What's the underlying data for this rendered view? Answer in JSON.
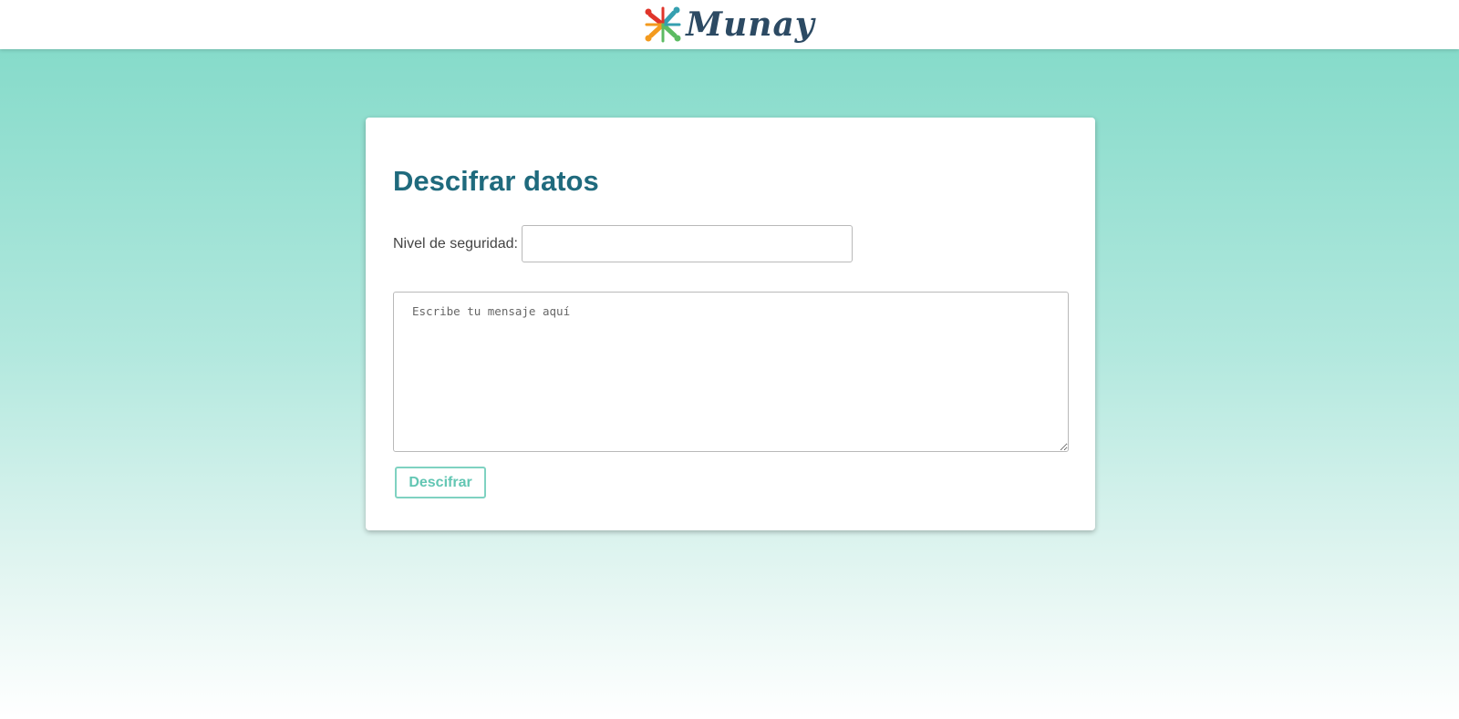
{
  "header": {
    "brand": "Munay",
    "logo_colors": [
      "#e0352b",
      "#f39a1e",
      "#5dbb63",
      "#35a0b0"
    ]
  },
  "form": {
    "title": "Descifrar datos",
    "level_label": "Nivel de seguridad:",
    "level_value": "",
    "message_placeholder": "Escribe tu mensaje aquí",
    "message_value": "",
    "submit_label": "Descifrar"
  },
  "colors": {
    "title": "#1f6a7d",
    "button_text": "#62c6b3",
    "button_border": "#7fd2c1",
    "gradient_top": "#86dbca"
  }
}
